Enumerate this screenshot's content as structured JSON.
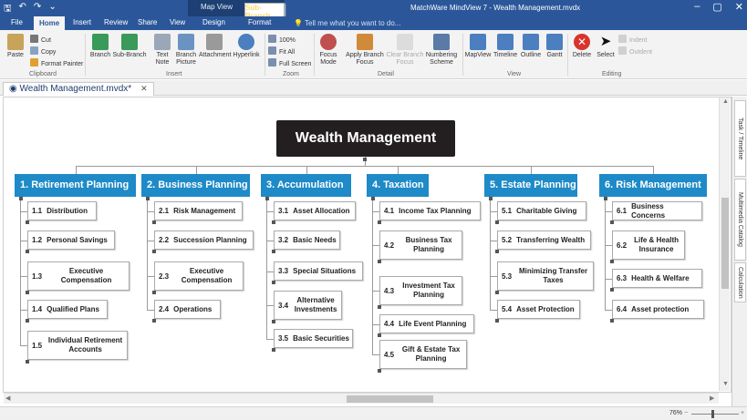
{
  "window": {
    "title": "MatchWare MindView 7 - Wealth Management.mvdx",
    "context_group_label": "Map View",
    "context_sub_label": "Sub-Branch",
    "buttons": [
      "–",
      "▢",
      "✕"
    ]
  },
  "quick_access": [
    "save-icon",
    "undo-icon",
    "redo-icon",
    "customize-icon"
  ],
  "tabs": [
    "File",
    "Home",
    "Insert",
    "Review",
    "Share",
    "View",
    "Design",
    "Format"
  ],
  "active_tab": "Home",
  "tell_me": "Tell me what you want to do...",
  "ribbon": {
    "clipboard": {
      "paste": "Paste",
      "cut": "Cut",
      "copy": "Copy",
      "format_painter": "Format Painter",
      "label": "Clipboard"
    },
    "insert": {
      "branch": "Branch",
      "sub_branch": "Sub-Branch",
      "text_note": "Text Note",
      "branch_picture": "Branch Picture",
      "attachment": "Attachment",
      "hyperlink": "Hyperlink",
      "label": "Insert"
    },
    "zoom": {
      "pct": "100%",
      "fit_all": "Fit All",
      "full_screen": "Full Screen",
      "label": "Zoom"
    },
    "detail": {
      "focus_mode": "Focus Mode",
      "apply_branch_focus": "Apply Branch Focus",
      "clear_branch_focus": "Clear Branch Focus",
      "numbering_scheme": "Numbering Scheme",
      "label": "Detail"
    },
    "view": {
      "mapview": "MapView",
      "timeline": "Timeline",
      "outline": "Outline",
      "gantt": "Gantt",
      "label": "View"
    },
    "editing": {
      "delete": "Delete",
      "select": "Select",
      "indent": "Indent",
      "outdent": "Outdent",
      "label": "Editing"
    }
  },
  "document_tab": "Wealth Management.mvdx*",
  "side_tabs": [
    "Task / Timeline",
    "Multimedia Catalog",
    "Calculation"
  ],
  "zoom_level": "76%",
  "map": {
    "root": "Wealth Management",
    "branches": [
      {
        "num": "1.",
        "label": "Retirement Planning",
        "subs": [
          {
            "num": "1.1",
            "label": "Distribution"
          },
          {
            "num": "1.2",
            "label": "Personal Savings"
          },
          {
            "num": "1.3",
            "label": "Executive Compensation"
          },
          {
            "num": "1.4",
            "label": "Qualified Plans"
          },
          {
            "num": "1.5",
            "label": "Individual Retirement Accounts"
          }
        ]
      },
      {
        "num": "2.",
        "label": "Business Planning",
        "subs": [
          {
            "num": "2.1",
            "label": "Risk Management"
          },
          {
            "num": "2.2",
            "label": "Succession Planning"
          },
          {
            "num": "2.3",
            "label": "Executive Compensation"
          },
          {
            "num": "2.4",
            "label": "Operations"
          }
        ]
      },
      {
        "num": "3.",
        "label": "Accumulation",
        "subs": [
          {
            "num": "3.1",
            "label": "Asset Allocation"
          },
          {
            "num": "3.2",
            "label": "Basic Needs"
          },
          {
            "num": "3.3",
            "label": "Special Situations"
          },
          {
            "num": "3.4",
            "label": "Alternative Investments"
          },
          {
            "num": "3.5",
            "label": "Basic Securities"
          }
        ]
      },
      {
        "num": "4.",
        "label": "Taxation",
        "subs": [
          {
            "num": "4.1",
            "label": "Income Tax Planning"
          },
          {
            "num": "4.2",
            "label": "Business Tax Planning"
          },
          {
            "num": "4.3",
            "label": "Investment Tax Planning"
          },
          {
            "num": "4.4",
            "label": "Life Event Planning"
          },
          {
            "num": "4.5",
            "label": "Gift & Estate Tax Planning"
          }
        ]
      },
      {
        "num": "5.",
        "label": "Estate Planning",
        "subs": [
          {
            "num": "5.1",
            "label": "Charitable Giving"
          },
          {
            "num": "5.2",
            "label": "Transferring Wealth"
          },
          {
            "num": "5.3",
            "label": "Minimizing Transfer Taxes"
          },
          {
            "num": "5.4",
            "label": "Asset Protection"
          }
        ]
      },
      {
        "num": "6.",
        "label": "Risk Management",
        "subs": [
          {
            "num": "6.1",
            "label": "Business Concerns"
          },
          {
            "num": "6.2",
            "label": "Life & Health Insurance"
          },
          {
            "num": "6.3",
            "label": "Health & Welfare"
          },
          {
            "num": "6.4",
            "label": "Asset protection"
          }
        ]
      }
    ]
  },
  "colors": {
    "titlebar": "#2b579a",
    "branch": "#1e8ac7",
    "root": "#231f20"
  }
}
